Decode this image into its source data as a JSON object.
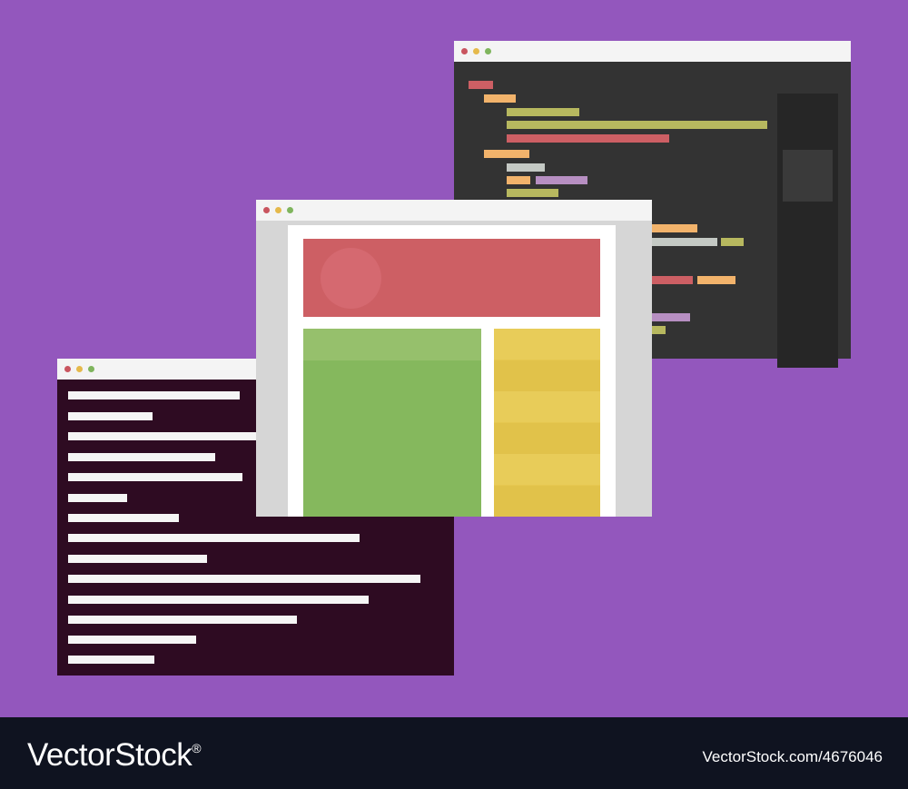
{
  "colors": {
    "background": "#9357bd",
    "titlebar": "#f4f4f4",
    "dot_red": "#c9555f",
    "dot_yellow": "#e5b94b",
    "dot_green": "#7fb55d",
    "editor_bg": "#333333",
    "terminal_bg": "#2e0b22",
    "browser_chrome": "#d6d6d6",
    "hero": "#cd5f64",
    "main_column": "#85b85d",
    "side_column": "#e6c74f",
    "footer": "#0f1320"
  },
  "windows": {
    "editor": {
      "icon": "code-editor-window"
    },
    "terminal": {
      "icon": "terminal-window"
    },
    "browser": {
      "icon": "browser-window"
    }
  },
  "footer": {
    "brand_name": "VectorStock",
    "brand_mark": "®",
    "image_id": "VectorStock.com/4676046"
  }
}
